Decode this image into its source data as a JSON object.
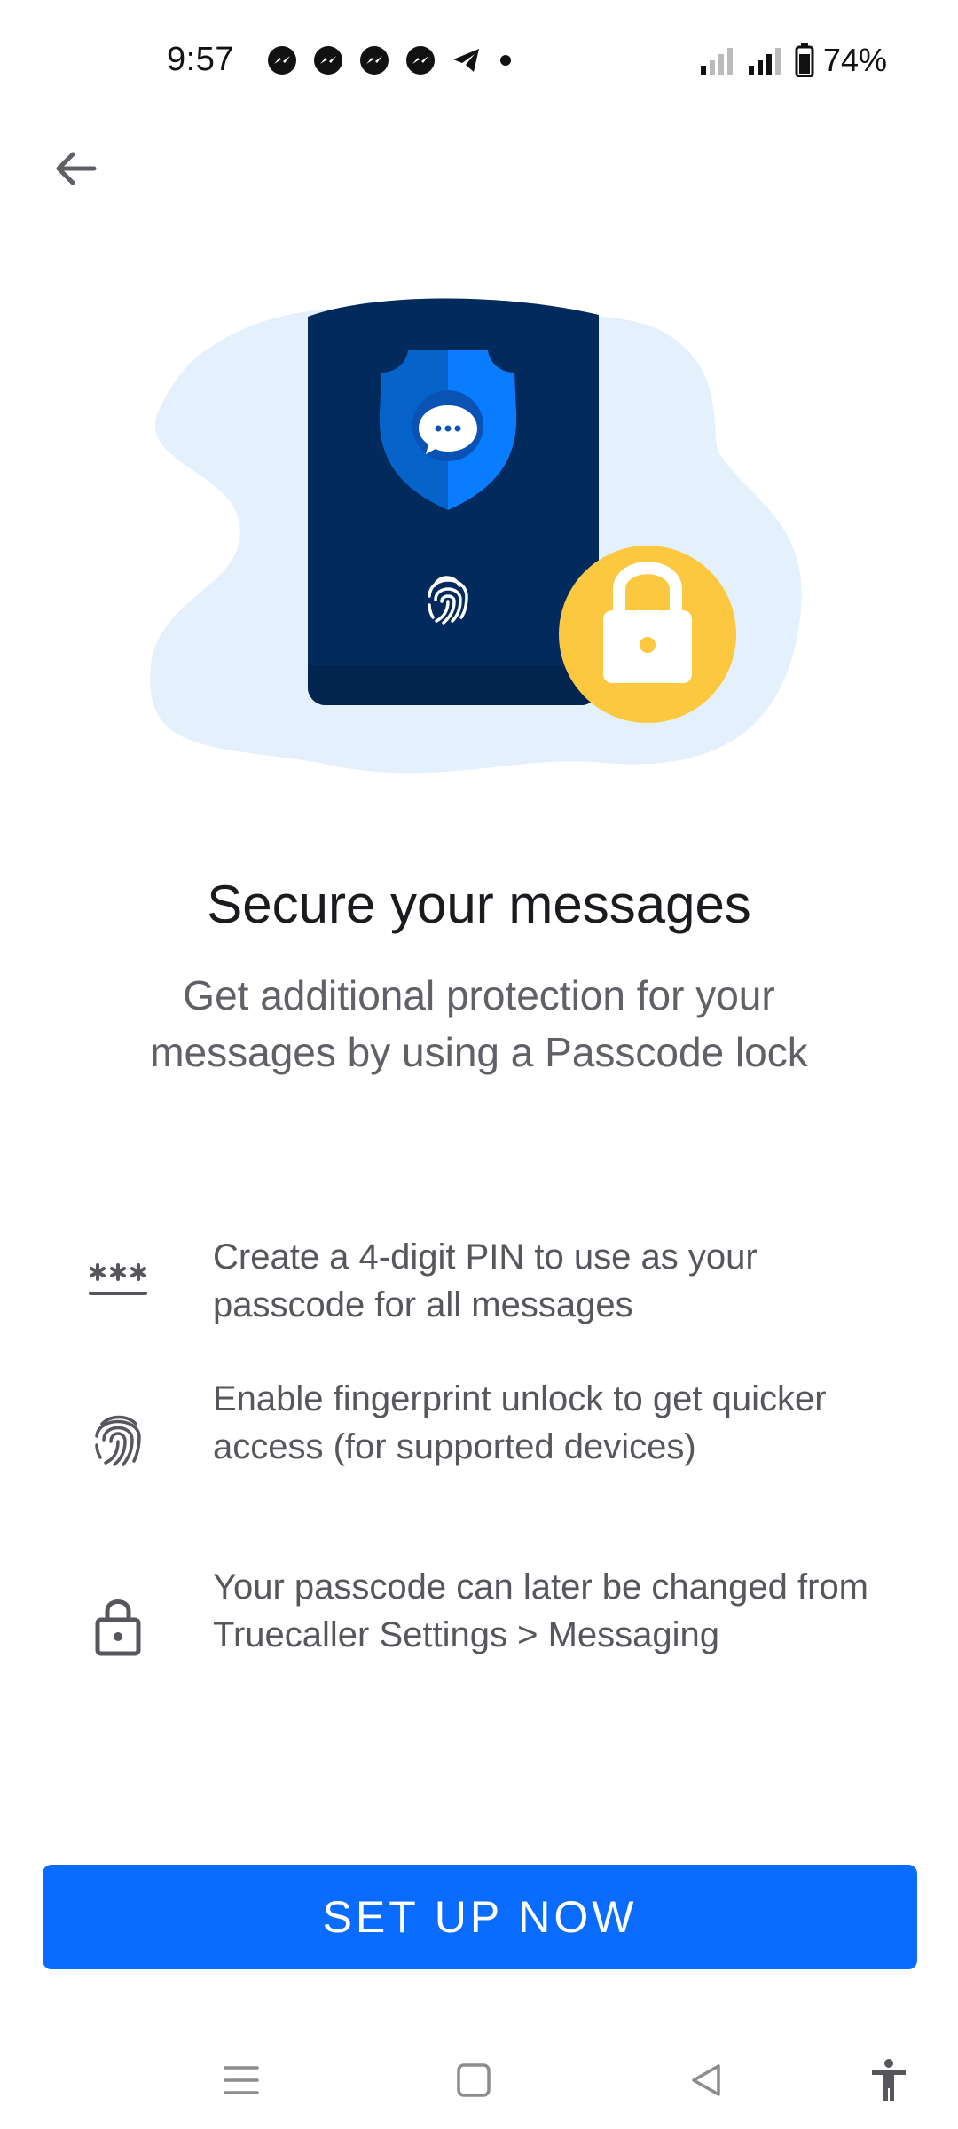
{
  "status_bar": {
    "time": "9:57",
    "battery": "74%",
    "notification_icons": [
      "messenger-icon",
      "messenger-icon",
      "messenger-icon",
      "messenger-icon",
      "telegram-icon",
      "dot-icon"
    ]
  },
  "header": {
    "back_icon": "arrow-left-icon"
  },
  "main": {
    "title": "Secure your messages",
    "subtitle": "Get additional protection for your messages by using a Passcode lock",
    "features": [
      {
        "icon": "pin-asterisks-icon",
        "text": "Create a 4-digit PIN to use as your passcode for all messages"
      },
      {
        "icon": "fingerprint-icon",
        "text": "Enable fingerprint unlock to get quicker access (for supported devices)"
      },
      {
        "icon": "lock-icon",
        "text": "Your passcode can later be changed from Truecaller Settings > Messaging"
      }
    ]
  },
  "cta": {
    "label": "SET UP NOW"
  },
  "colors": {
    "accent": "#0a6cff",
    "phone_navy": "#032a5c",
    "lock_yellow": "#fbc840",
    "blob_light_blue": "#e4f0fb"
  },
  "nav_bar": {
    "icons": [
      "menu-icon",
      "home-square-icon",
      "back-triangle-icon",
      "accessibility-icon"
    ]
  }
}
